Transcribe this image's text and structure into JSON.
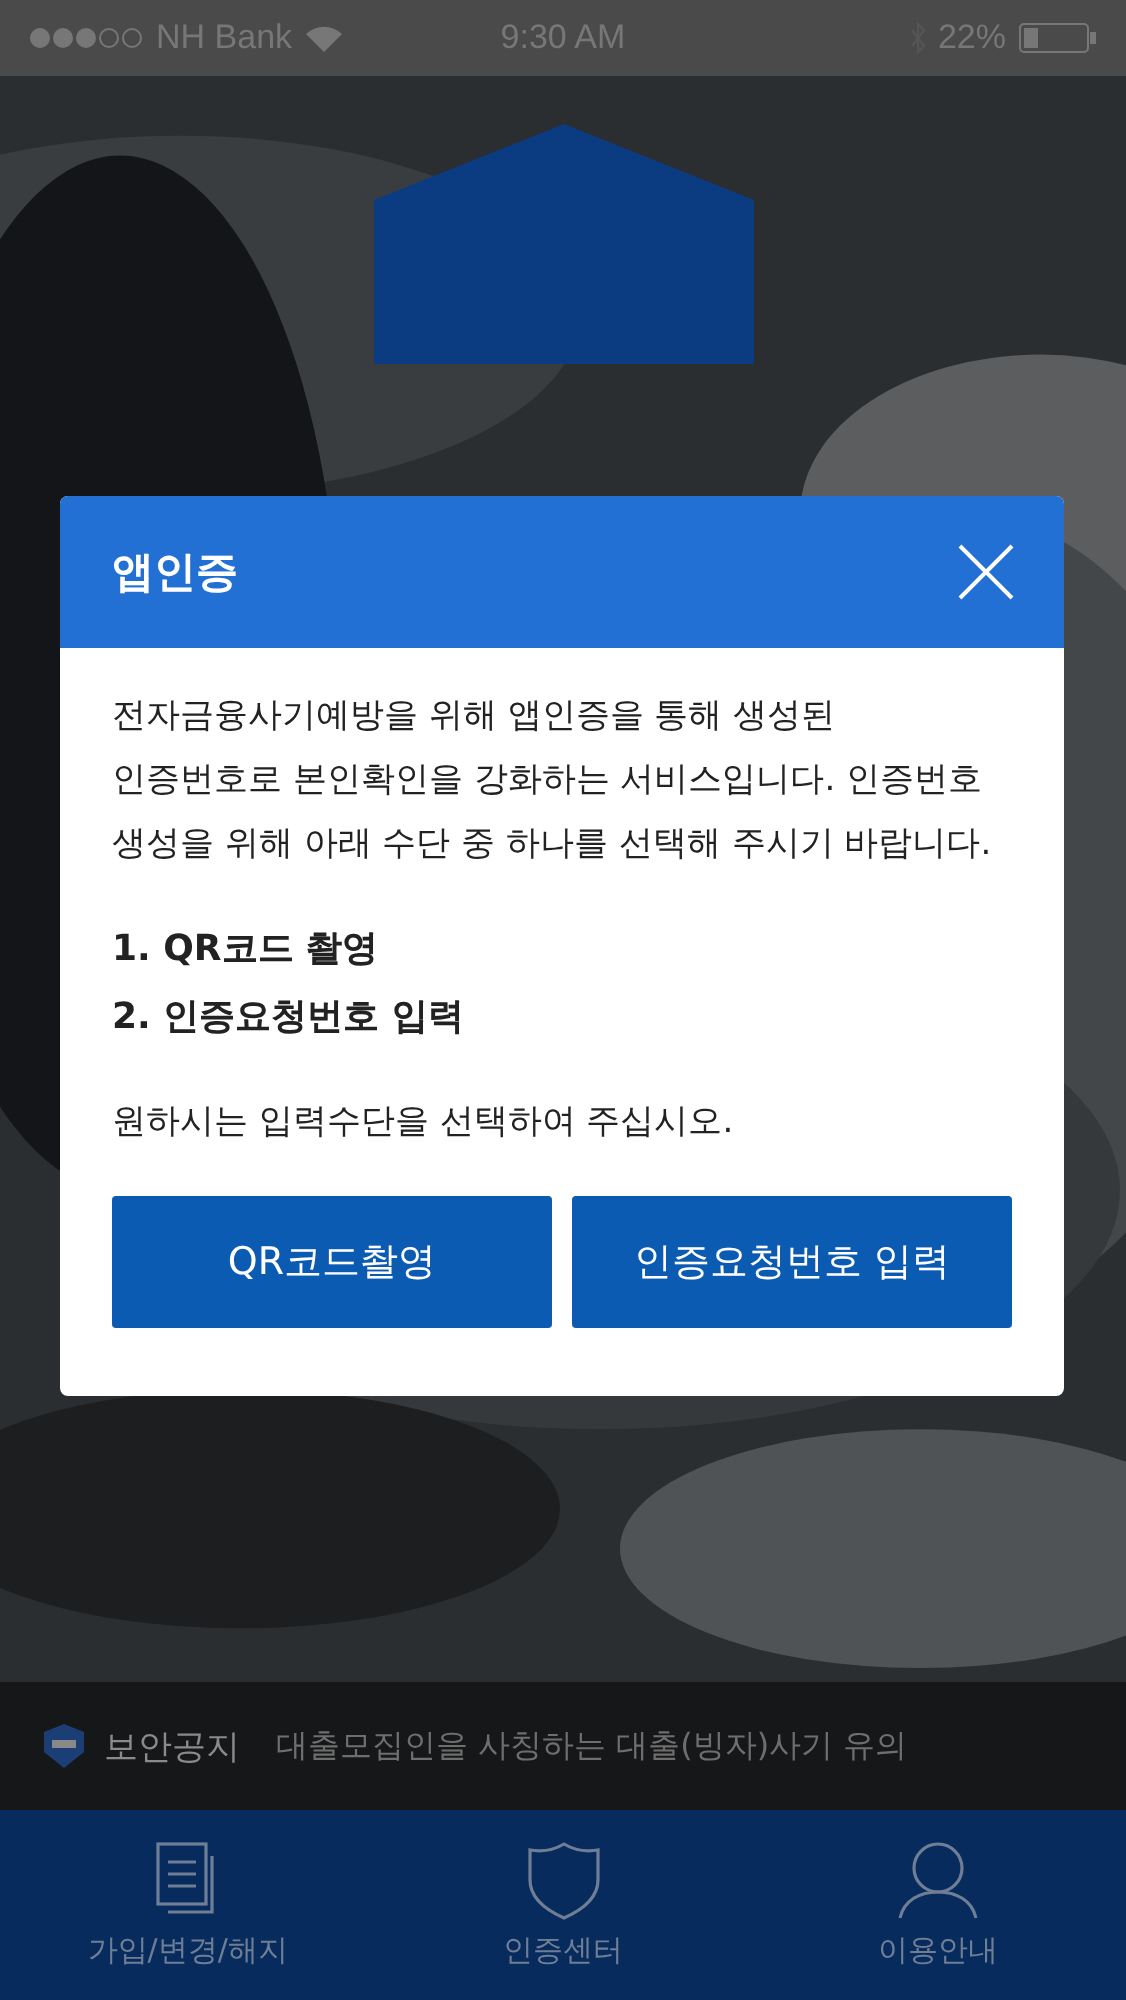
{
  "status_bar": {
    "carrier": "NH Bank",
    "time": "9:30 AM",
    "battery": "22%"
  },
  "dialog": {
    "title": "앱인증",
    "message": "전자금융사기예방을 위해 앱인증을 통해 생성된 인증번호로 본인확인을 강화하는 서비스입니다. 인증번호 생성을 위해 아래 수단 중 하나를 선택해 주시기 바랍니다.",
    "options": [
      "1. QR코드 촬영",
      "2. 인증요청번호 입력"
    ],
    "prompt": "원하시는 입력수단을 선택하여 주십시오.",
    "buttons": [
      "QR코드촬영",
      "인증요청번호 입력"
    ]
  },
  "notice": {
    "label": "보안공지",
    "text": "대출모집인을 사칭하는 대출(빙자)사기 유의"
  },
  "tab_bar": [
    {
      "kind": "document",
      "label": "가입/변경/해지"
    },
    {
      "kind": "shield",
      "label": "인증센터"
    },
    {
      "kind": "person",
      "label": "이용안내"
    }
  ]
}
